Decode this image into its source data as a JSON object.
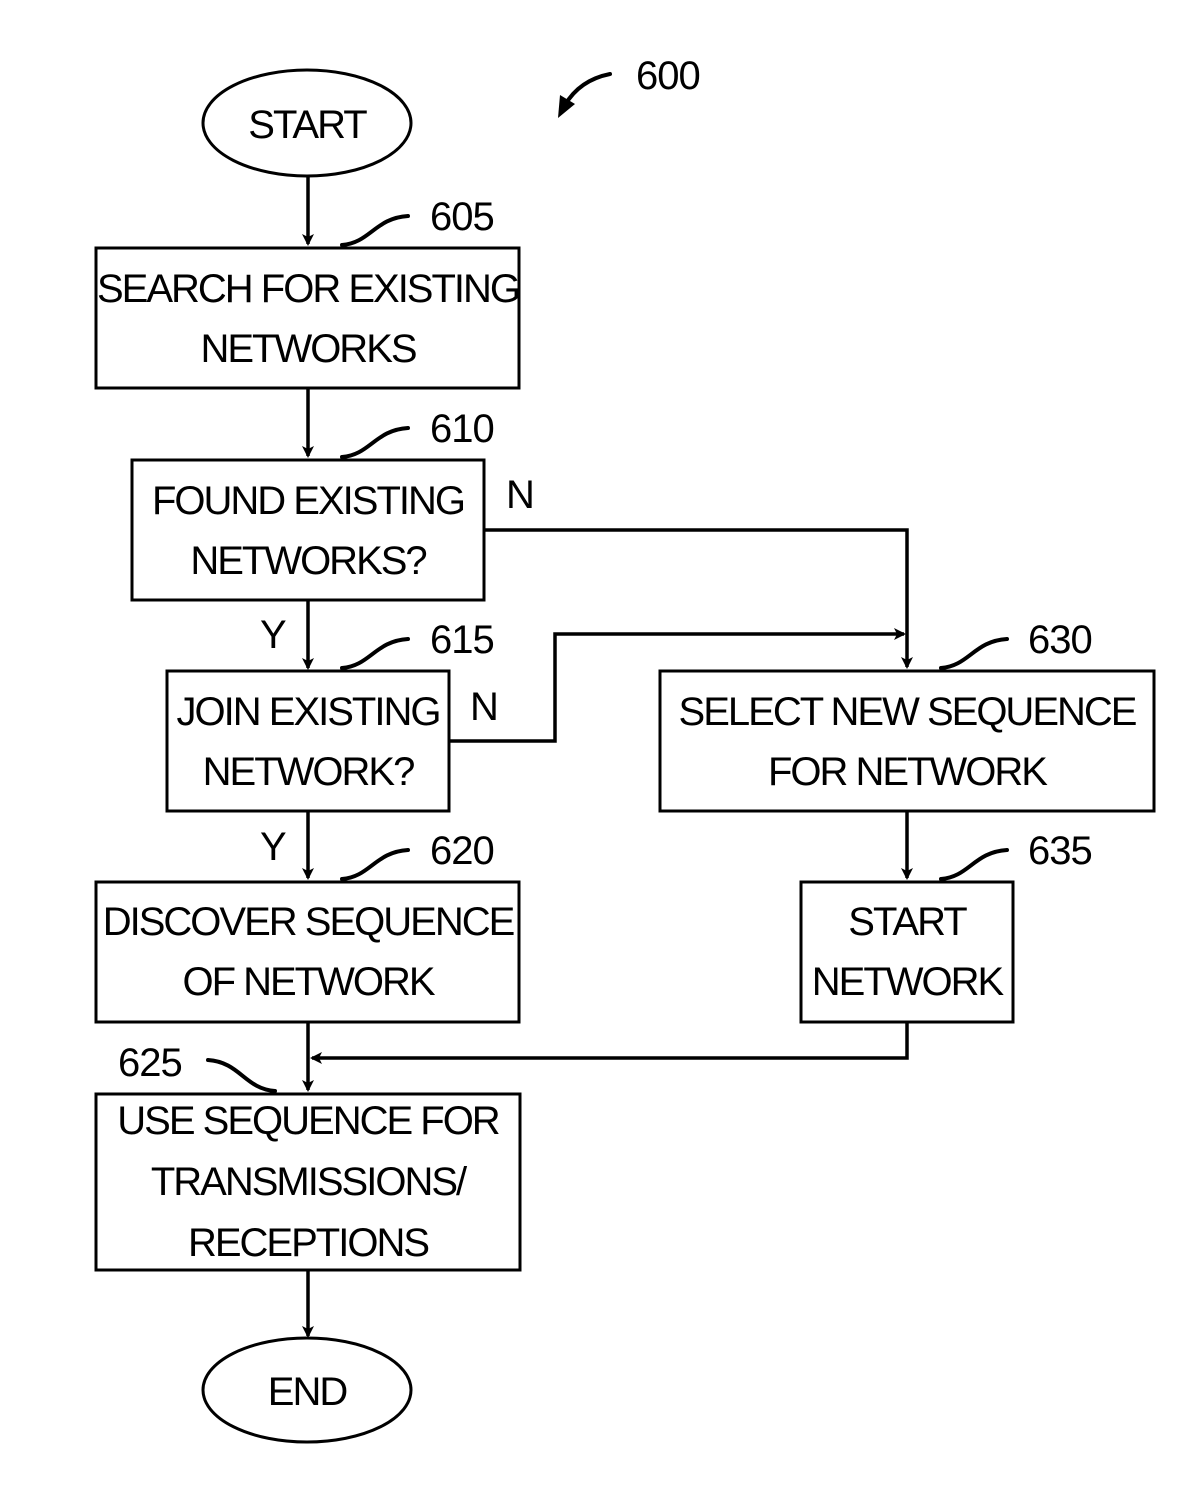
{
  "figure": {
    "ref": "600",
    "nodes": {
      "start": {
        "label": [
          "START"
        ]
      },
      "n605": {
        "ref": "605",
        "label": [
          "SEARCH FOR EXISTING",
          "NETWORKS"
        ]
      },
      "n610": {
        "ref": "610",
        "label": [
          "FOUND EXISTING",
          "NETWORKS?"
        ]
      },
      "n615": {
        "ref": "615",
        "label": [
          "JOIN EXISTING",
          "NETWORK?"
        ]
      },
      "n620": {
        "ref": "620",
        "label": [
          "DISCOVER SEQUENCE",
          "OF NETWORK"
        ]
      },
      "n625": {
        "ref": "625",
        "label": [
          "USE SEQUENCE FOR",
          "TRANSMISSIONS/",
          "RECEPTIONS"
        ]
      },
      "n630": {
        "ref": "630",
        "label": [
          "SELECT NEW SEQUENCE",
          "FOR NETWORK"
        ]
      },
      "n635": {
        "ref": "635",
        "label": [
          "START",
          "NETWORK"
        ]
      },
      "end": {
        "label": [
          "END"
        ]
      }
    },
    "edges": {
      "e610_yes": "Y",
      "e610_no": "N",
      "e615_yes": "Y",
      "e615_no": "N"
    }
  }
}
